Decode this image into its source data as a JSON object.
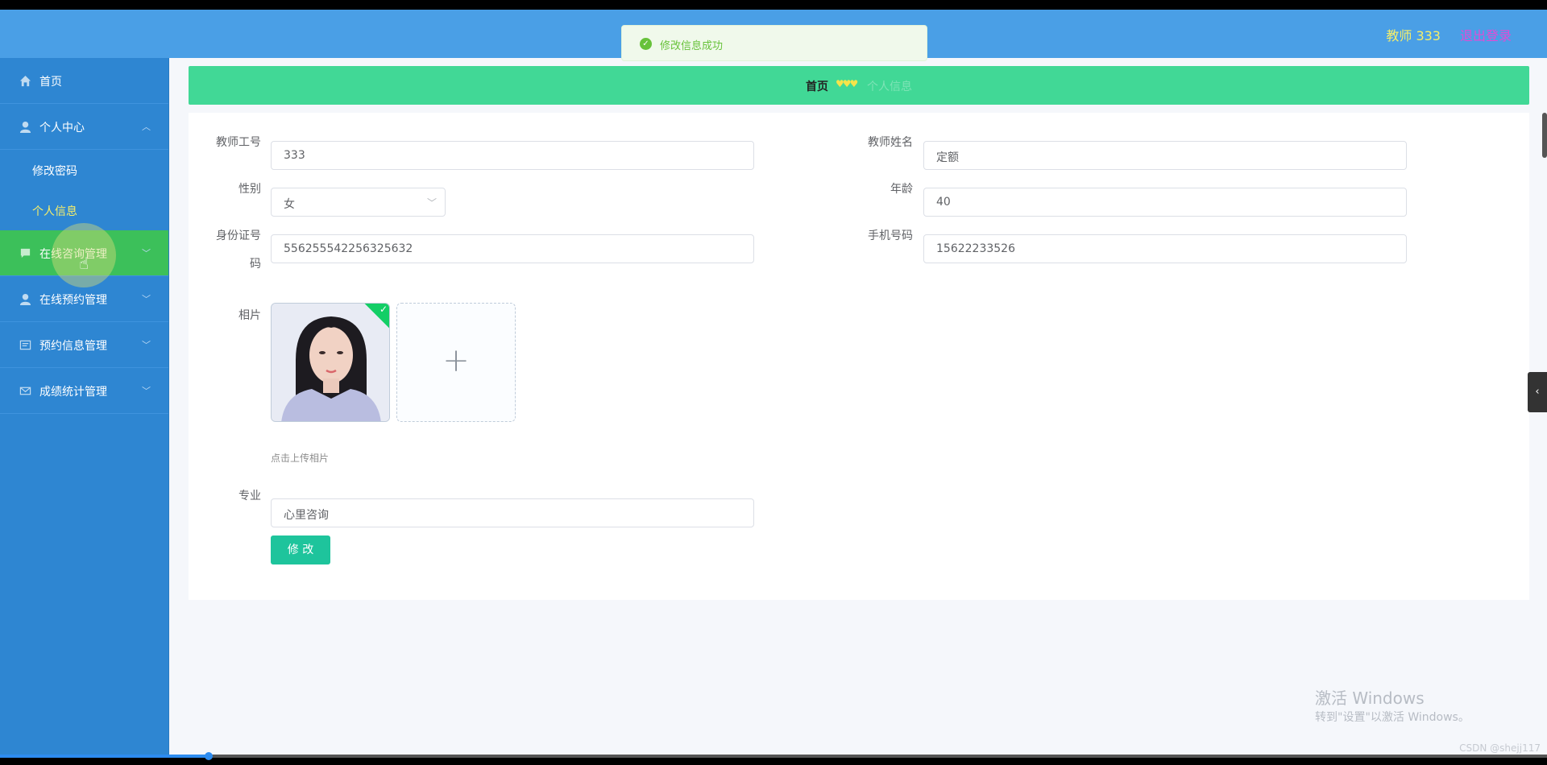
{
  "header": {
    "user": "教师 333",
    "logout": "退出登录"
  },
  "toast": {
    "message": "修改信息成功",
    "icon": "success-check-icon"
  },
  "sidebar": {
    "items": [
      {
        "label": "首页",
        "icon": "home-icon",
        "arrow": ""
      },
      {
        "label": "个人中心",
        "icon": "user-icon",
        "arrow": "︿"
      },
      {
        "label": "在线咨询管理",
        "icon": "chat-icon",
        "arrow": "﹀"
      },
      {
        "label": "在线预约管理",
        "icon": "user-icon",
        "arrow": "﹀"
      },
      {
        "label": "预约信息管理",
        "icon": "list-icon",
        "arrow": "﹀"
      },
      {
        "label": "成绩统计管理",
        "icon": "mail-icon",
        "arrow": "﹀"
      }
    ],
    "subitems": [
      {
        "label": "修改密码"
      },
      {
        "label": "个人信息"
      }
    ]
  },
  "breadcrumb": {
    "home": "首页",
    "separator": "♥♥♥",
    "current": "个人信息"
  },
  "form": {
    "teacher_id": {
      "label": "教师工号",
      "value": "333"
    },
    "teacher_name": {
      "label": "教师姓名",
      "value": "定额"
    },
    "gender": {
      "label": "性别",
      "value": "女"
    },
    "age": {
      "label": "年龄",
      "value": "40"
    },
    "id_card": {
      "label_line1": "身份证号",
      "label_line2": "码",
      "value": "556255542256325632"
    },
    "phone": {
      "label": "手机号码",
      "value": "15622233526"
    },
    "photo": {
      "label": "相片",
      "hint": "点击上传相片"
    },
    "major": {
      "label": "专业",
      "value": "心里咨询"
    },
    "submit": "修 改"
  },
  "watermark": {
    "line1": "激活 Windows",
    "line2": "转到\"设置\"以激活 Windows。"
  },
  "credit": "CSDN @shejj117",
  "video_progress": 0.135,
  "colors": {
    "header": "#4a9fe6",
    "sidebar": "#2e86d2",
    "sidebar_active": "#3cc05a",
    "breadcrumb": "#41d896",
    "button": "#1ec49c",
    "highlight_text": "#f6ee6a"
  }
}
